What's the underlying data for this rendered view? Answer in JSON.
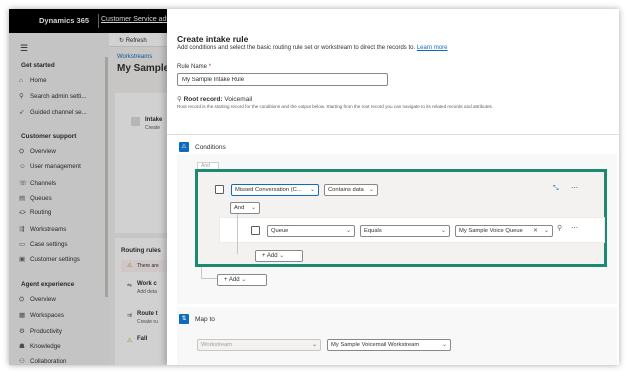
{
  "topbar": {
    "brand": "Dynamics 365",
    "app_name": "Customer Service admin center"
  },
  "sidebar": {
    "sections": [
      {
        "title": "Get started",
        "items": [
          {
            "label": "Home",
            "icon": "home-icon",
            "glyph": "⌂"
          },
          {
            "label": "Search admin setti...",
            "icon": "search-icon",
            "glyph": "⚲"
          },
          {
            "label": "Guided channel se...",
            "icon": "rocket-icon",
            "glyph": "➶"
          }
        ]
      },
      {
        "title": "Customer support",
        "items": [
          {
            "label": "Overview",
            "icon": "overview-icon",
            "glyph": "⛭"
          },
          {
            "label": "User management",
            "icon": "people-icon",
            "glyph": "☺"
          },
          {
            "label": "Channels",
            "icon": "channels-icon",
            "glyph": "☏"
          },
          {
            "label": "Queues",
            "icon": "queues-icon",
            "glyph": "▤"
          },
          {
            "label": "Routing",
            "icon": "routing-icon",
            "glyph": "⛮"
          },
          {
            "label": "Workstreams",
            "icon": "workstreams-icon",
            "glyph": "⇶"
          },
          {
            "label": "Case settings",
            "icon": "case-icon",
            "glyph": "▭"
          },
          {
            "label": "Customer settings",
            "icon": "customer-icon",
            "glyph": "▣"
          }
        ]
      },
      {
        "title": "Agent experience",
        "items": [
          {
            "label": "Overview",
            "icon": "overview-icon",
            "glyph": "⛭"
          },
          {
            "label": "Workspaces",
            "icon": "workspaces-icon",
            "glyph": "▦"
          },
          {
            "label": "Productivity",
            "icon": "productivity-icon",
            "glyph": "⚙"
          },
          {
            "label": "Knowledge",
            "icon": "knowledge-icon",
            "glyph": "☗"
          },
          {
            "label": "Collaboration",
            "icon": "collaboration-icon",
            "glyph": "⚇"
          }
        ]
      }
    ]
  },
  "background_page": {
    "refresh_label": "Refresh",
    "breadcrumb": "Workstreams",
    "title": "My Sample",
    "card1_title": "Intake",
    "card1_sub": "Create",
    "routing_header": "Routing rules",
    "warning_text": "There are",
    "rows": [
      {
        "title": "Work c",
        "sub": "Add deta"
      },
      {
        "title": "Route t",
        "sub": "Create ru"
      },
      {
        "title": "Fall",
        "sub": ""
      }
    ]
  },
  "dialog": {
    "title": "Create intake rule",
    "subtitle": "Add conditions and select the basic routing rule set or workstream to direct the records to.",
    "learn_more": "Learn more",
    "rule_name_label": "Rule Name",
    "required_mark": "*",
    "rule_name_value": "My Sample Intake Rule",
    "root_record_label": "Root record:",
    "root_record_value": "Voicemail",
    "root_record_desc": "Root record is the starting record for the conditions and the output below. Starting from the root record you can navigate to its related records and attributes.",
    "conditions_label": "Conditions",
    "and_ghost": "And",
    "condition1": {
      "field": "Missed Conversation (C...",
      "operator": "Contains data"
    },
    "group_operator": "And",
    "condition2": {
      "field": "Queue",
      "operator": "Equals",
      "value": "My Sample Voice Queue"
    },
    "add_inner_label": "Add",
    "add_outer_label": "Add",
    "map_to_label": "Map to",
    "map_type": "Workstream",
    "map_value": "My Sample Voicemail Workstream"
  },
  "colors": {
    "highlight_border": "#1c8a6e",
    "accent": "#0f6cbd",
    "topbar": "#000000"
  }
}
